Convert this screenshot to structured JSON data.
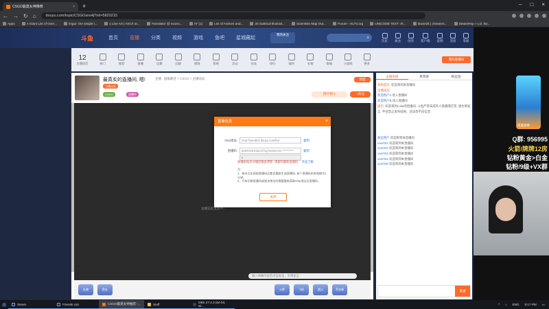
{
  "browser": {
    "tab_title": "CSGO最莫女神推荐",
    "url": "douyu.com/topic/CSGOsns4j?rid=5820215",
    "bookmarks": [
      "Apps",
      "A Giant List of Over...",
      "imgur: the simple i...",
      "1 Line Art | ASCII ar...",
      "Translator @ econo...",
      "AT (1)",
      "List of Animes and...",
      "20 Satirical Illustrat...",
      "Scientists Map Out...",
      "Forum - HLTV.org",
      "UNICODE TEXT √K...",
      "Davie2k | cheaters...",
      "SteamRep » Lol. Bo..."
    ]
  },
  "site": {
    "logo": "斗鱼",
    "nav": [
      "首页",
      "直播",
      "分类",
      "视频",
      "游戏",
      "鱼吧",
      "星城藏起"
    ],
    "live_button": "我的关注",
    "header_icons": [
      "历史",
      "关注",
      "创作",
      "客户端",
      "说明",
      "消息",
      "等级"
    ],
    "follow_count": "12",
    "follow_label": "主播动态",
    "sub_items": [
      "热门",
      "推荐",
      "直播",
      "比赛",
      "回放",
      "视频",
      "鱼吧",
      "活动",
      "任务",
      "排行",
      "福利",
      "礼物",
      "商城",
      "小游戏",
      "更多",
      "节日"
    ],
    "sub_right": "我的直播间"
  },
  "room": {
    "title": "最真实的直播间, 嗯!",
    "meta": "主播 · 国服最佳 > CSGO > 主播动态",
    "tags": [
      "主播认证",
      "CSGO",
      "直播中"
    ],
    "follow_label": "排行榜 1",
    "follow_btn": "+关注",
    "hot": "热度",
    "player_msg": "主播正在准备中...",
    "danmu_placeholder": "输入弹幕内容后点击发送，文明发言",
    "gifts": [
      "礼物",
      "鱼丸",
      "火箭",
      "飞机",
      "超火",
      "荧光棒"
    ]
  },
  "chat": {
    "tabs": [
      "主播等级",
      "贵宾榜",
      "粉丝团"
    ],
    "lines": [
      {
        "user": "系统提示:",
        "text": "欢迎来到本直播间"
      },
      {
        "user": "主播动态",
        "text": ""
      },
      {
        "user": "欢迎用户A",
        "text": "进入直播间"
      },
      {
        "user": "欢迎用户B",
        "text": "进入直播间"
      },
      {
        "user": "提示:",
        "text": "欢迎来到Loka的直播间, 斗鱼严禁未成年人直播或打赏, 请文明发言, 平台禁止发布低俗、违法等不良信息"
      },
      {
        "user": "粉丝用户",
        "text": "欢迎来到本直播间"
      },
      {
        "user": "user001",
        "text": "欢迎来到本直播间"
      },
      {
        "user": "user002",
        "text": "欢迎来到本直播间"
      },
      {
        "user": "user003",
        "text": "欢迎来到本直播间"
      },
      {
        "user": "user004",
        "text": "欢迎来到本直播间"
      },
      {
        "user": "user005",
        "text": "欢迎来到本直播间"
      }
    ],
    "send": "发送"
  },
  "modal": {
    "title": "直播信息",
    "rtmp_label": "rtmp地址:",
    "rtmp_value": "rtmp://sendtc3.douyu.com/live",
    "code_label": "直播码:",
    "code_value": "5820215rD2aC372g?wsSecret=**********",
    "code_hint": "",
    "copy": "复制",
    "warning": "直播码每次开播后都会更新, 请复制最新直播码",
    "learn_more": "点击了解",
    "notes_title": "注:",
    "notes": [
      "1、每次点击获取直播码后都会重新生成直播码, 每个直播码的有效期为1分钟。",
      "2、只有切换直播间或推流地址时需要重新获取rtmp地址及直播码。"
    ],
    "ok": "关闭"
  },
  "overlay": {
    "lines": [
      {
        "text": "Q群: 956995",
        "color": "#ffffff"
      },
      {
        "text": "火箭/牌牌12房",
        "color": "#ffd54a"
      },
      {
        "text": "钻粉黄金>白金",
        "color": "#ffffff"
      },
      {
        "text": "钻粉/9级+VX群",
        "color": "#ffffff"
      }
    ],
    "badge_label": "荣誉勋章"
  },
  "taskbar": {
    "items": [
      "Steam",
      "Friends List",
      "CSGO最莫女神推荐 -...",
      "Stuff",
      "OBS 27.2.3 (64-bit, wi..."
    ],
    "time": "9:17 PM",
    "lang": "ENG"
  }
}
